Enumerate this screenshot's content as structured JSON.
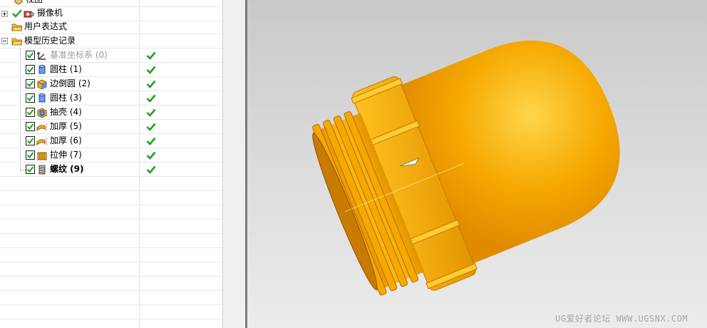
{
  "navigator": {
    "rows": [
      {
        "label": "视图",
        "icon": "view-icon",
        "checked": false,
        "has_check": false,
        "status": false
      },
      {
        "label": "摄像机",
        "icon": "camera-icon",
        "checked": true,
        "has_check": false,
        "status": false
      },
      {
        "label": "用户表达式",
        "icon": "folder-open-icon",
        "checked": false,
        "has_check": false,
        "status": false
      },
      {
        "label": "模型历史记录",
        "icon": "folder-open-icon",
        "checked": false,
        "has_check": false,
        "status": false
      },
      {
        "label": "基准坐标系 (0)",
        "icon": "datum-csys-icon",
        "checked": true,
        "has_check": true,
        "status": true,
        "style": "dim"
      },
      {
        "label": "圆柱 (1)",
        "icon": "cylinder-icon",
        "checked": true,
        "has_check": true,
        "status": true
      },
      {
        "label": "边倒圆 (2)",
        "icon": "edge-blend-icon",
        "checked": true,
        "has_check": true,
        "status": true
      },
      {
        "label": "圆柱 (3)",
        "icon": "cylinder-icon",
        "checked": true,
        "has_check": true,
        "status": true
      },
      {
        "label": "抽壳 (4)",
        "icon": "shell-icon",
        "checked": true,
        "has_check": true,
        "status": true
      },
      {
        "label": "加厚 (5)",
        "icon": "thicken-icon",
        "checked": true,
        "has_check": true,
        "status": true
      },
      {
        "label": "加厚 (6)",
        "icon": "thicken-icon",
        "checked": true,
        "has_check": true,
        "status": true
      },
      {
        "label": "拉伸 (7)",
        "icon": "extrude-icon",
        "checked": true,
        "has_check": true,
        "status": true
      },
      {
        "label": "螺纹 (9)",
        "icon": "thread-icon",
        "checked": true,
        "has_check": true,
        "status": true,
        "style": "bold"
      }
    ]
  },
  "viewport": {
    "watermark": "UG爱好者论坛 WWW.UGSNX.COM",
    "model_color": "#f5a800"
  },
  "colors": {
    "status_green": "#1aa31a",
    "model_shadow": "#c97a00",
    "model_highlight": "#ffd24a"
  }
}
